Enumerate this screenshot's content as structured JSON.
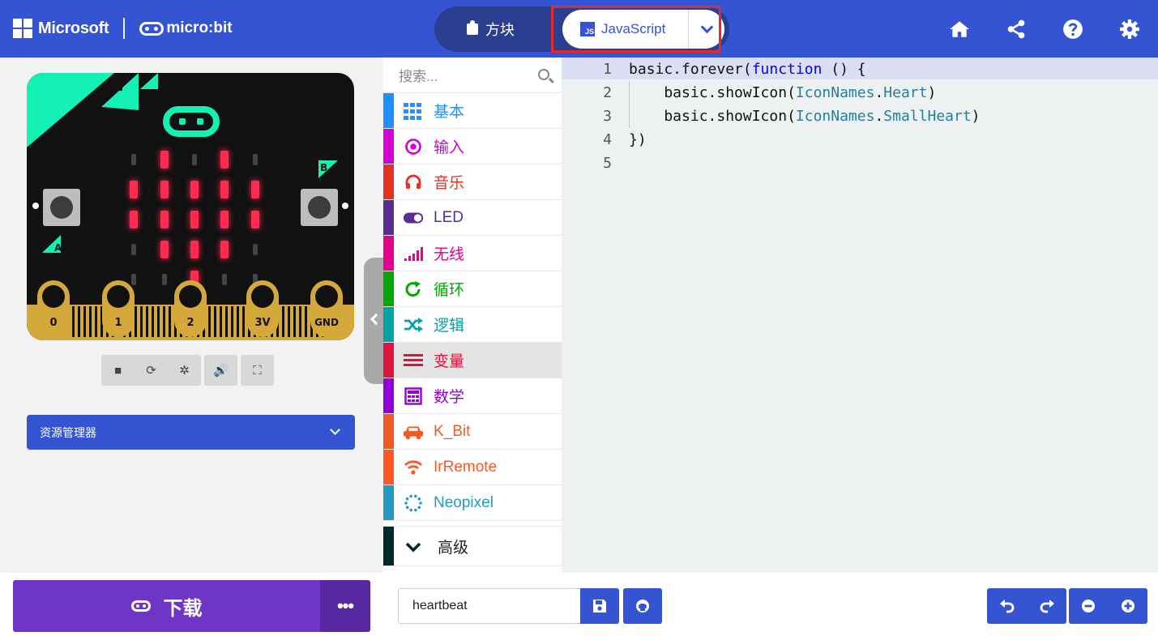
{
  "header": {
    "brand_microsoft": "Microsoft",
    "brand_microbit": "micro:bit",
    "toggle_blocks_label": "方块",
    "toggle_js_label": "JavaScript",
    "js_icon_text": "JS",
    "icons": [
      "home-icon",
      "share-icon",
      "help-icon",
      "settings-icon"
    ]
  },
  "simulator": {
    "pins": [
      "0",
      "1",
      "2",
      "3V",
      "GND"
    ],
    "button_a": "A",
    "button_b": "B",
    "led_on": [
      [
        0,
        1,
        0,
        1,
        0
      ],
      [
        1,
        1,
        1,
        1,
        1
      ],
      [
        1,
        1,
        1,
        1,
        1
      ],
      [
        0,
        1,
        1,
        1,
        0
      ],
      [
        0,
        0,
        1,
        0,
        0
      ]
    ],
    "controls": [
      "stop-icon",
      "restart-icon",
      "debug-icon",
      "mute-icon",
      "fullscreen-icon"
    ],
    "explorer_label": "资源管理器"
  },
  "toolbox": {
    "search_placeholder": "搜索...",
    "categories": [
      {
        "label": "基本",
        "color": "#1e90ff"
      },
      {
        "label": "输入",
        "color": "#d400d4"
      },
      {
        "label": "音乐",
        "color": "#e63022"
      },
      {
        "label": "LED",
        "color": "#5c2d91"
      },
      {
        "label": "无线",
        "color": "#e3008c"
      },
      {
        "label": "循环",
        "color": "#00aa00"
      },
      {
        "label": "逻辑",
        "color": "#00a4a6"
      },
      {
        "label": "变量",
        "color": "#dc143c"
      },
      {
        "label": "数学",
        "color": "#9400d3"
      },
      {
        "label": "K_Bit",
        "color": "#f15a24"
      },
      {
        "label": "IrRemote",
        "color": "#ff5722"
      },
      {
        "label": "Neopixel",
        "color": "#2699bf"
      }
    ],
    "advanced_label": "高级",
    "advanced_color": "#00272b"
  },
  "editor": {
    "lines": [
      "1",
      "2",
      "3",
      "4",
      "5"
    ],
    "code": {
      "l1_a": "basic.forever(",
      "l1_kw": "function",
      "l1_b": " () {",
      "l2_a": "    basic.showIcon(",
      "l2_ty": "IconNames",
      "l2_b": ".",
      "l2_c": "Heart",
      "l2_d": ")",
      "l3_a": "    basic.showIcon(",
      "l3_ty": "IconNames",
      "l3_b": ".",
      "l3_c": "SmallHeart",
      "l3_d": ")",
      "l4": "})",
      "l5": ""
    }
  },
  "bottom": {
    "download_label": "下载",
    "more_label": "•••",
    "project_name": "heartbeat"
  },
  "colors": {
    "primary": "#3454d1",
    "download": "#6f35c7",
    "highlight": "#e22a2a",
    "led": "#ff2a4f",
    "board_accent": "#14f1b4",
    "pin_gold": "#d4a83b"
  }
}
